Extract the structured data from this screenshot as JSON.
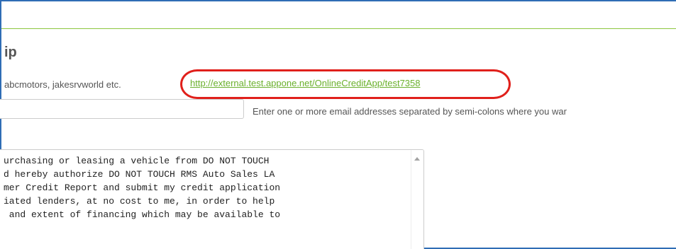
{
  "section": {
    "title": "ip"
  },
  "share_link": {
    "hint": "abcmotors, jakesrvworld etc.",
    "url": "http://external.test.appone.net/OnlineCreditApp/test7358"
  },
  "email_field": {
    "value": "",
    "help_text": "Enter one or more email addresses separated by semi-colons where you war"
  },
  "disclosure": {
    "lines": [
      "urchasing or leasing a vehicle from DO NOT TOUCH",
      "d hereby authorize DO NOT TOUCH RMS Auto Sales LA",
      "mer Credit Report and submit my credit application",
      "iated lenders, at no cost to me, in order to help",
      " and extent of financing which may be available to"
    ]
  },
  "colors": {
    "link": "#6ab02c",
    "highlight_oval": "#e0201b",
    "divider": "#8cc63f",
    "frame_border": "#2f6db5"
  },
  "icons": {
    "scroll_up": "scroll-up-arrow-icon"
  }
}
